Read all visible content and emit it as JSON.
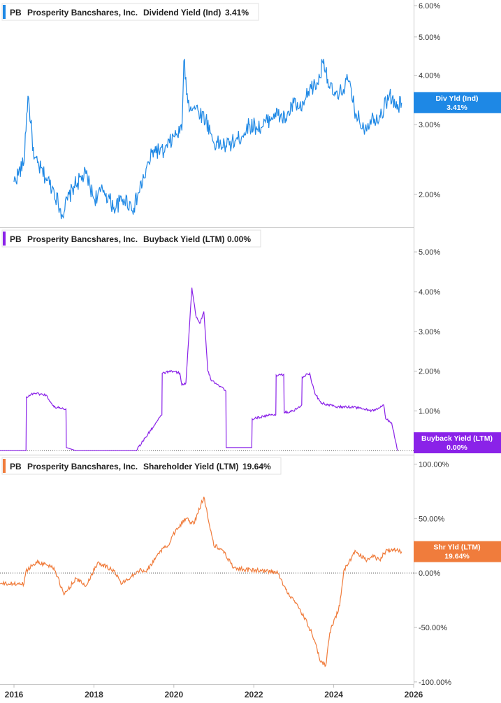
{
  "chart_data": [
    {
      "type": "line",
      "scale": "log",
      "ticker": "PB",
      "company": "Prosperity Bancshares, Inc.",
      "metric": "Dividend Yield (Ind)",
      "current_value": "3.41%",
      "badge_label": "Div Yld (Ind)",
      "badge_value": "3.41%",
      "color": "#1e88e5",
      "ylim": [
        1.65,
        6.2
      ],
      "y_ticks": [
        {
          "value": 6,
          "label": "6.00%"
        },
        {
          "value": 5,
          "label": "5.00%"
        },
        {
          "value": 4,
          "label": "4.00%"
        },
        {
          "value": 3,
          "label": "3.00%"
        },
        {
          "value": 2,
          "label": "2.00%"
        }
      ],
      "x": [
        2016.0,
        2016.25,
        2016.35,
        2016.5,
        2016.8,
        2017.0,
        2017.2,
        2017.5,
        2017.8,
        2018.0,
        2018.25,
        2018.5,
        2018.75,
        2019.0,
        2019.25,
        2019.5,
        2019.75,
        2020.0,
        2020.2,
        2020.25,
        2020.35,
        2020.55,
        2020.8,
        2021.0,
        2021.3,
        2021.6,
        2021.9,
        2022.2,
        2022.5,
        2022.8,
        2023.0,
        2023.2,
        2023.4,
        2023.6,
        2023.75,
        2023.9,
        2024.1,
        2024.35,
        2024.55,
        2024.75,
        2024.95,
        2025.2,
        2025.4,
        2025.55,
        2025.7
      ],
      "values": [
        2.15,
        2.4,
        3.55,
        2.45,
        2.2,
        2.05,
        1.78,
        2.1,
        2.25,
        1.95,
        2.05,
        1.85,
        1.95,
        1.85,
        2.2,
        2.6,
        2.55,
        2.8,
        2.9,
        4.35,
        3.4,
        3.3,
        3.1,
        2.7,
        2.65,
        2.75,
        3.0,
        2.95,
        3.2,
        3.1,
        3.4,
        3.25,
        3.7,
        3.8,
        4.4,
        3.7,
        3.5,
        3.9,
        3.2,
        2.95,
        3.1,
        3.2,
        3.6,
        3.3,
        3.41
      ]
    },
    {
      "type": "line",
      "scale": "linear",
      "ticker": "PB",
      "company": "Prosperity Bancshares, Inc.",
      "metric": "Buyback Yield (LTM)",
      "current_value": "0.00%",
      "badge_label": "Buyback Yield (LTM)",
      "badge_value": "0.00%",
      "color": "#8a22e8",
      "ylim": [
        -0.1,
        5.6
      ],
      "y_ticks": [
        {
          "value": 5,
          "label": "5.00%"
        },
        {
          "value": 4,
          "label": "4.00%"
        },
        {
          "value": 3,
          "label": "3.00%"
        },
        {
          "value": 2,
          "label": "2.00%"
        },
        {
          "value": 1,
          "label": "1.00%"
        }
      ],
      "x": [
        2015.65,
        2016.3,
        2016.31,
        2016.5,
        2016.8,
        2017.0,
        2017.3,
        2017.31,
        2017.55,
        2019.05,
        2019.7,
        2019.71,
        2019.95,
        2020.15,
        2020.2,
        2020.3,
        2020.45,
        2020.55,
        2020.65,
        2020.75,
        2020.85,
        2020.95,
        2021.05,
        2021.3,
        2021.31,
        2021.95,
        2021.96,
        2022.4,
        2022.55,
        2022.56,
        2022.75,
        2022.76,
        2023.0,
        2023.2,
        2023.21,
        2023.4,
        2023.45,
        2023.55,
        2023.7,
        2023.85,
        2024.1,
        2024.5,
        2024.75,
        2025.0,
        2025.25,
        2025.3,
        2025.45,
        2025.6
      ],
      "values": [
        0.0,
        0.0,
        1.35,
        1.45,
        1.4,
        1.1,
        1.05,
        0.08,
        0.0,
        0.0,
        0.9,
        1.95,
        2.0,
        1.95,
        1.65,
        1.7,
        4.1,
        3.4,
        3.2,
        3.5,
        2.0,
        1.75,
        1.7,
        1.5,
        0.08,
        0.08,
        0.8,
        0.9,
        0.9,
        1.9,
        1.92,
        0.95,
        1.0,
        1.15,
        1.85,
        1.95,
        1.7,
        1.4,
        1.2,
        1.15,
        1.1,
        1.1,
        1.05,
        1.0,
        1.15,
        0.8,
        0.7,
        0.0
      ]
    },
    {
      "type": "line",
      "scale": "linear",
      "ticker": "PB",
      "company": "Prosperity Bancshares, Inc.",
      "metric": "Shareholder Yield (LTM)",
      "current_value": "19.64%",
      "badge_label": "Shr Yld (LTM)",
      "badge_value": "19.64%",
      "color": "#f07c3c",
      "ylim": [
        -102,
        108
      ],
      "y_ticks": [
        {
          "value": 100,
          "label": "100.00%"
        },
        {
          "value": 50,
          "label": "50.00%"
        },
        {
          "value": 0,
          "label": "0.00%"
        },
        {
          "value": -50,
          "label": "-50.00%"
        },
        {
          "value": -100,
          "label": "-100.00%"
        }
      ],
      "x": [
        2015.65,
        2016.25,
        2016.3,
        2016.55,
        2016.8,
        2017.0,
        2017.25,
        2017.55,
        2017.8,
        2018.1,
        2018.5,
        2018.7,
        2019.1,
        2019.35,
        2019.65,
        2019.85,
        2020.05,
        2020.3,
        2020.5,
        2020.75,
        2021.0,
        2021.2,
        2021.5,
        2021.8,
        2022.2,
        2022.6,
        2022.8,
        2023.0,
        2023.25,
        2023.45,
        2023.55,
        2023.65,
        2023.8,
        2023.9,
        2024.15,
        2024.25,
        2024.55,
        2024.8,
        2025.0,
        2025.15,
        2025.3,
        2025.45,
        2025.7
      ],
      "values": [
        -10,
        -10,
        2,
        10,
        8,
        5,
        -20,
        -5,
        -12,
        10,
        2,
        -10,
        2,
        3,
        20,
        25,
        40,
        50,
        45,
        70,
        25,
        22,
        5,
        3,
        2,
        0,
        -15,
        -25,
        -40,
        -55,
        -65,
        -80,
        -85,
        -55,
        -30,
        2,
        20,
        12,
        15,
        12,
        20,
        22,
        19.64
      ]
    }
  ],
  "x_axis": {
    "xlim": [
      2015.65,
      2026.0
    ],
    "ticks": [
      {
        "value": 2016,
        "label": "2016"
      },
      {
        "value": 2018,
        "label": "2018"
      },
      {
        "value": 2020,
        "label": "2020"
      },
      {
        "value": 2022,
        "label": "2022"
      },
      {
        "value": 2024,
        "label": "2024"
      },
      {
        "value": 2026,
        "label": "2026"
      }
    ]
  }
}
